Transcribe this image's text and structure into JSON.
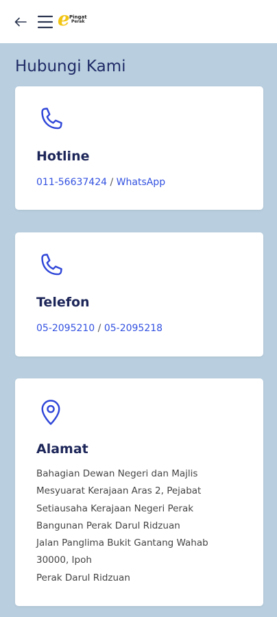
{
  "header": {
    "logo_text_line1": "Pingat",
    "logo_text_line2": "Perak"
  },
  "page": {
    "title": "Hubungi Kami"
  },
  "cards": {
    "hotline": {
      "icon": "phone-icon",
      "title": "Hotline",
      "phone": "011-56637424",
      "separator": " / ",
      "whatsapp": "WhatsApp"
    },
    "telefon": {
      "icon": "phone-icon",
      "title": "Telefon",
      "phone1": "05-2095210",
      "separator": " / ",
      "phone2": "05-2095218"
    },
    "alamat": {
      "icon": "location-pin-icon",
      "title": "Alamat",
      "lines": [
        "Bahagian Dewan Negeri dan Majlis",
        "Mesyuarat Kerajaan Aras 2, Pejabat",
        "Setiausaha Kerajaan Negeri Perak",
        "Bangunan Perak Darul Ridzuan",
        "Jalan Panglima Bukit Gantang Wahab",
        "30000, Ipoh",
        "Perak Darul Ridzuan"
      ]
    }
  },
  "colors": {
    "accent": "#3150e0",
    "title": "#1f2a66",
    "background": "#b9cfdf",
    "logo": "#f2c514"
  }
}
